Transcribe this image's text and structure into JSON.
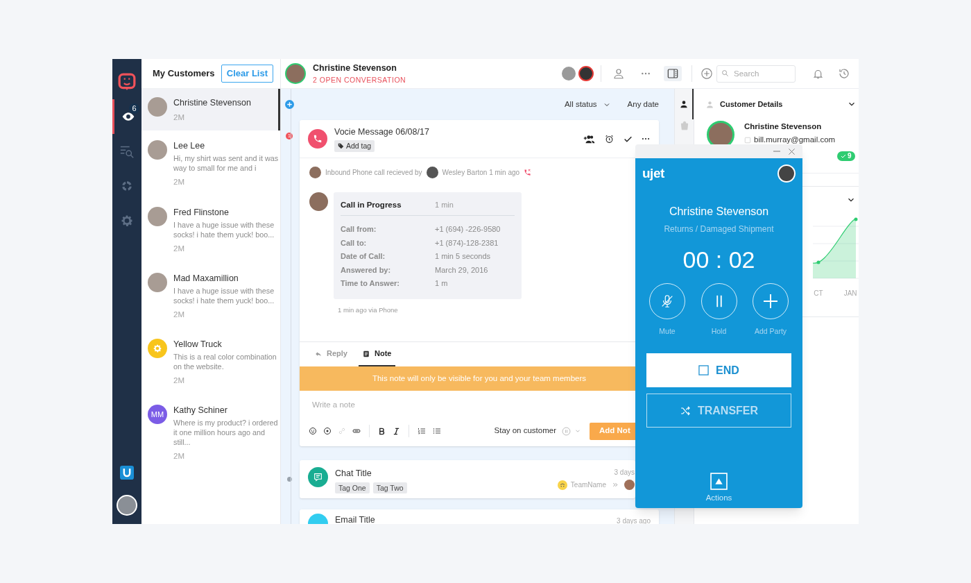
{
  "rail": {
    "items": [
      {
        "kind": "logo",
        "selected": false
      },
      {
        "kind": "eye",
        "selected": true,
        "badge": "6"
      },
      {
        "kind": "search-list",
        "selected": false
      },
      {
        "kind": "donut",
        "selected": false
      },
      {
        "kind": "gear",
        "selected": false
      }
    ]
  },
  "customer_list": {
    "title": "My Customers",
    "clear_button": "Clear List",
    "items": [
      {
        "name": "Christine Stevenson",
        "time": "2M",
        "selected": true,
        "avatar": {
          "kind": "photo"
        }
      },
      {
        "name": "Lee Lee",
        "preview": "Hi, my shirt was sent and it was way to small for me and i",
        "time": "2M",
        "selected": false,
        "avatar": {
          "kind": "photo"
        }
      },
      {
        "name": "Fred Flinstone",
        "preview": "I have a huge issue with these socks! i hate them yuck! boo...",
        "time": "2M",
        "selected": false,
        "avatar": {
          "kind": "photo"
        }
      },
      {
        "name": "Mad Maxamillion",
        "preview": "I have a huge issue with these socks! i hate them yuck! boo...",
        "time": "2M",
        "selected": false,
        "avatar": {
          "kind": "photo"
        }
      },
      {
        "name": "Yellow Truck",
        "preview": "This is a real color combination on the website.",
        "time": "2M",
        "selected": false,
        "avatar": {
          "kind": "icon"
        }
      },
      {
        "name": "Kathy Schiner",
        "preview": "Where is my product? i ordered it one million hours ago and still...",
        "time": "2M",
        "selected": false,
        "avatar": {
          "kind": "initials",
          "initials": "MM"
        }
      }
    ]
  },
  "header": {
    "name": "Christine Stevenson",
    "subtitle": "2 OPEN CONVERSATION",
    "search": {
      "placeholder": "Search"
    }
  },
  "filters": [
    {
      "label": "All status",
      "dropdown": true
    },
    {
      "label": "Any date",
      "dropdown": false
    }
  ],
  "voice_card": {
    "unread": "1",
    "title": "Vocie Message 06/08/17",
    "tag_button": "Add tag",
    "event": {
      "text": "Inbound Phone call recieved by",
      "agent": "Wesley Barton 1 min ago"
    },
    "call": {
      "title": "Call in Progress",
      "duration": "1 min",
      "rows": [
        {
          "label": "Call from:",
          "value": "+1 (694) -226-9580"
        },
        {
          "label": "Call to:",
          "value": "+1 (874)-128-2381"
        },
        {
          "label": "Date of Call:",
          "value": "1 min 5 seconds"
        },
        {
          "label": "Answered by:",
          "value": "March 29, 2016"
        },
        {
          "label": "Time to Answer:",
          "value": "1 m"
        }
      ]
    },
    "footer": "1 min ago via Phone"
  },
  "composer": {
    "tabs": [
      {
        "label": "Reply",
        "selected": false
      },
      {
        "label": "Note",
        "selected": true
      }
    ],
    "banner": "This note will only be visible for you and your team members",
    "placeholder": "Write a note",
    "stay": "Stay on customer",
    "submit": "Add Not"
  },
  "conversations": [
    {
      "kind": "chat",
      "title": "Chat Title",
      "tags": [
        "Tag One",
        "Tag Two"
      ],
      "time": "3 days",
      "team": "TeamName"
    },
    {
      "kind": "email",
      "title": "Email Title",
      "time": "3 days ago"
    }
  ],
  "details": {
    "title": "Customer Details",
    "name": "Christine Stevenson",
    "email": "bill.murray@gmail.com",
    "badge": "9",
    "chart_labels": [
      "CT",
      "JAN"
    ]
  },
  "call_widget": {
    "brand": "ujet",
    "name": "Christine Stevenson",
    "topic": "Returns / Damaged Shipment",
    "timer": "00 : 02",
    "controls": [
      {
        "kind": "mute",
        "label": "Mute"
      },
      {
        "kind": "hold",
        "label": "Hold"
      },
      {
        "kind": "add",
        "label": "Add Party"
      }
    ],
    "end": "END",
    "transfer": "TRANSFER",
    "actions": "Actions"
  }
}
